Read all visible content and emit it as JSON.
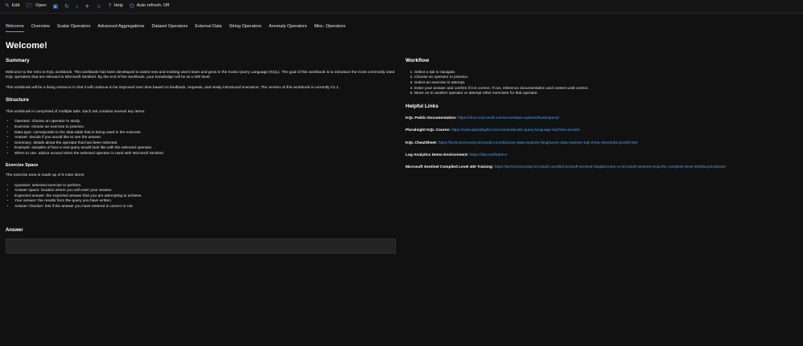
{
  "toolbar": {
    "items": [
      {
        "label": "Edit",
        "icon": "edit-icon",
        "glyph": "✎"
      },
      {
        "label": "Open",
        "icon": "folder-icon",
        "glyph": "🗁"
      },
      {
        "label": "",
        "icon": "save-icon",
        "glyph": "▣"
      },
      {
        "label": "",
        "icon": "refresh-icon",
        "glyph": "↻"
      },
      {
        "label": "",
        "icon": "bell-icon",
        "glyph": "♪"
      },
      {
        "label": "",
        "icon": "pin-icon",
        "glyph": "✈"
      },
      {
        "label": "",
        "icon": "smiley-icon",
        "glyph": "☺"
      },
      {
        "label": "Help",
        "icon": "help-icon",
        "glyph": "?"
      },
      {
        "label": "Auto refresh: Off",
        "icon": "clock-icon",
        "glyph": "◷"
      }
    ]
  },
  "tabs": [
    "Welcome",
    "Overview",
    "Scalar Operators",
    "Advanced Aggregations",
    "Dataset Operators",
    "External Data",
    "String Operators",
    "Anomaly Operators",
    "Misc. Operators"
  ],
  "title": "Welcome!",
  "summary": {
    "heading": "Summary",
    "p1": "Welcome to the Intro to KQL workbook. This workbook has been developed to assist new and existing users learn and grow in the Kusto Query Language (KQL). The goal of this workbook is to introduce the most commonly used KQL operators that are relevant to Microsoft Sentinel. By the end of the workbook, your knowledge will be at a 200 level.",
    "p2": "This workbook will be a living resource in that it will continue to be improved over time based on feedback, requests, and newly introduced scenarios. The version of this workbook is currently V1.1."
  },
  "structure": {
    "heading": "Structure",
    "intro": "This workbook is comprised of multiple tabs. Each tab contains several key items:",
    "items": [
      "Operator: choose an operator to study.",
      "Exercise: choose an exercise to practice.",
      "Data type: corresponds to the data table that is being used in the exercise.",
      "Answer: decide if you would like to see the answer.",
      "Summary: details about the operator that has been selected.",
      "Example: samples of how a real query would look like with the selected operator.",
      "When to use: advice around when the selected operator is used with Microsoft Sentinel."
    ]
  },
  "exercise_space": {
    "heading": "Exercise Space",
    "intro": "The exercise area is made up of 6 main items:",
    "items": [
      "Question: selected exercise to perform.",
      "Answer space: location where you will enter your answer.",
      "Expected answer: the expected answer that you are attempting to achieve.",
      "Your answer: the results from the query you have written.",
      "Answer Checker: lets if the answer you have entered is correct or not."
    ]
  },
  "answer": {
    "label": "Answer"
  },
  "workflow": {
    "heading": "Workflow",
    "items": [
      "Select a tab to navigate.",
      "Choose an operator to practice.",
      "Select an exercise to attempt.",
      "Enter your answer and confirm if it is correct. If not, reference documentation and content until correct.",
      "Move on to another operator or attempt other exercises for that operator."
    ]
  },
  "helpful_links": {
    "heading": "Helpful Links",
    "links": [
      {
        "label": "KQL Public Documentation:",
        "url": "https://docs.microsoft.com/azure/data-explorer/kusto/query/"
      },
      {
        "label": "Pluralsight KQL Course:",
        "url": "https://www.pluralsight.com/courses/kusto-query-language-kql-from-scratch"
      },
      {
        "label": "KQL CheatSheet:",
        "url": "https://techcommunity.microsoft.com/t5/azure-data-explorer-blog/azure-data-explorer-kql-cheat-sheets/ba-p/1057404"
      },
      {
        "label": "Log Analytics Demo Environment:",
        "url": "https://aka.ms/lademo"
      },
      {
        "label": "Microsoft Sentinel Compiled Level 400 Training:",
        "url": "https://techcommunity.microsoft.com/t5/microsoft-sentinel-blog/become-a-microsoft-sentinel-ninja-the-complete-level-400/ba-p/1246310"
      }
    ]
  },
  "colors": {
    "accent": "#4aa3ff",
    "background": "#111111",
    "answer_box": "#242424"
  }
}
